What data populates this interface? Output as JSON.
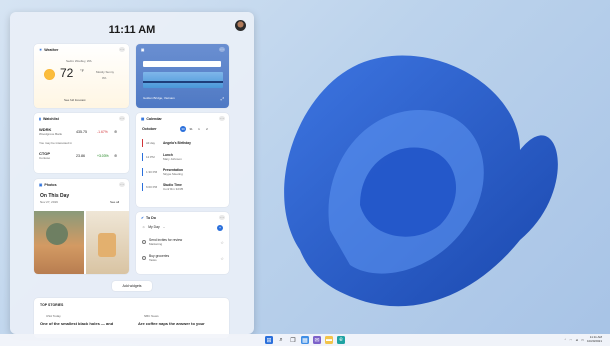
{
  "panel": {
    "time": "11:11 AM",
    "add_widgets": "Add widgets"
  },
  "weather": {
    "title": "Weather",
    "location": "Sedro Woolley, WA",
    "temp": "72",
    "unit": "°F",
    "desc": "Mostly Sunny",
    "precip": "0%",
    "forecast_link": "See full forecast"
  },
  "photo_widget": {
    "search_placeholder": "Search the web",
    "caption": "Golden Bridge, Vietnam"
  },
  "watchlist": {
    "title": "Watchlist",
    "rows": [
      {
        "symbol": "WDRK",
        "sub": "Woodgrove Bank",
        "value": "435.75",
        "change": "-1.67%"
      },
      {
        "symbol": "CTOP",
        "sub": "Contoso",
        "value": "23.86",
        "change": "+3.03%"
      }
    ],
    "note": "You may be interested in"
  },
  "calendar": {
    "title": "Calendar",
    "month": "October",
    "days": [
      "30",
      "31",
      "1",
      "2"
    ],
    "events": [
      {
        "time": "All day",
        "title": "Angela's Birthday",
        "sub": ""
      },
      {
        "time": "12 PM",
        "title": "Lunch",
        "sub": "Mary Johnson"
      },
      {
        "time": "1:30 PM",
        "title": "Presentation",
        "sub": "Skype Meeting"
      },
      {
        "time": "6:00 PM",
        "title": "Studio Time",
        "sub": "Conf Rm 32/35"
      }
    ]
  },
  "photos": {
    "title": "Photos",
    "heading": "On This Day",
    "date": "Nov 27, 2019",
    "see_all": "See all"
  },
  "todo": {
    "title": "To Do",
    "list": "My Day",
    "items": [
      {
        "text": "Send invites for review",
        "sub": "Marketing"
      },
      {
        "text": "Buy groceries",
        "sub": "Tasks"
      }
    ]
  },
  "stories": {
    "title": "TOP STORIES",
    "items": [
      {
        "source": "USA Today",
        "headline": "One of the smallest black holes — and"
      },
      {
        "source": "NBC News",
        "headline": "Are coffee naps the answer to your"
      }
    ]
  },
  "taskbar": {
    "time": "11:11 AM",
    "date": "10/20/2021"
  },
  "colors": {
    "accent": "#2a6fdb",
    "negative": "#d13438",
    "positive": "#107c10"
  }
}
